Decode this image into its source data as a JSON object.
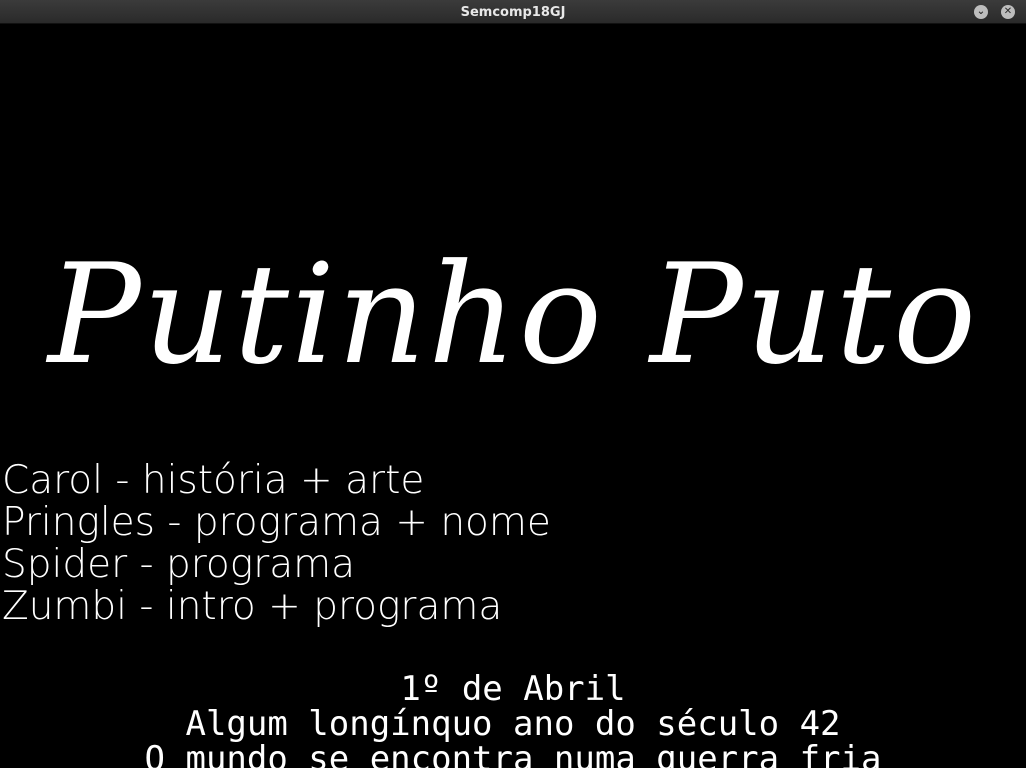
{
  "window": {
    "title": "Semcomp18GJ",
    "minimize_icon": "chevron-down-icon",
    "close_icon": "close-icon"
  },
  "game": {
    "logo": "Putinho Puto",
    "credits": [
      "Carol - história + arte",
      "Pringles - programa + nome",
      "Spider - programa",
      "Zumbi - intro + programa"
    ],
    "story": [
      "1º de Abril",
      "Algum longínquo ano do século 42",
      "O mundo se encontra numa guerra fria"
    ]
  }
}
